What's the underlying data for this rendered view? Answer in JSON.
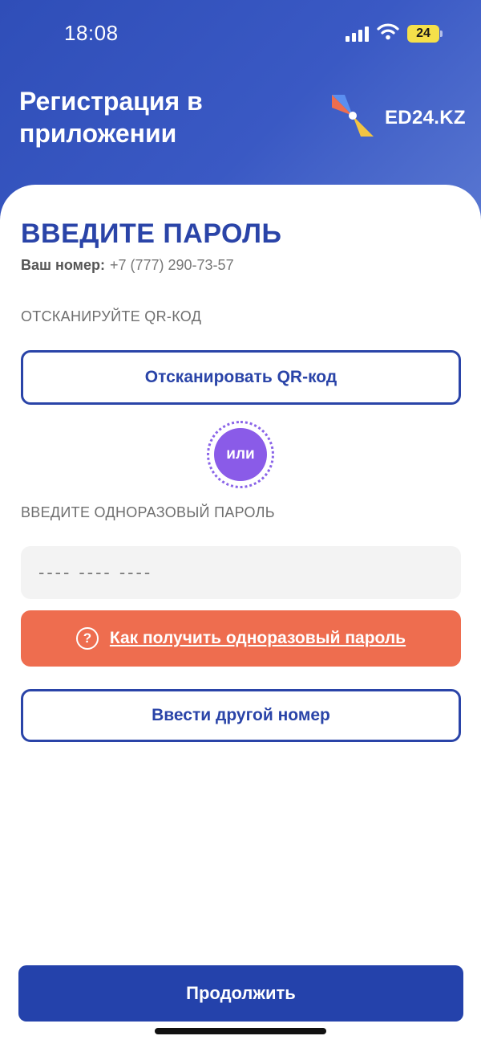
{
  "status_bar": {
    "time": "18:08",
    "battery": "24",
    "signal_icon": "cellular-signal-icon",
    "wifi_icon": "wifi-icon"
  },
  "header": {
    "title": "Регистрация в приложении",
    "logo_text": "ED24.KZ",
    "logo_icon": "pinwheel-logo-icon"
  },
  "form": {
    "heading": "ВВЕДИТЕ ПАРОЛЬ",
    "phone_label": "Ваш номер:",
    "phone_value": "+7 (777) 290-73-57",
    "qr_section_label": "ОТСКАНИРУЙТЕ QR-КОД",
    "scan_button": "Отсканировать QR-код",
    "or_label": "или",
    "otp_section_label": "ВВЕДИТЕ ОДНОРАЗОВЫЙ ПАРОЛЬ",
    "otp_placeholder": "---- ---- ----",
    "help_button": "Как получить одноразовый пароль",
    "help_icon_glyph": "?",
    "change_number_button": "Ввести другой номер"
  },
  "footer": {
    "continue_button": "Продолжить"
  },
  "colors": {
    "brand_blue": "#2a44a8",
    "accent_orange": "#ee6d4f",
    "accent_purple": "#8a5be8"
  }
}
